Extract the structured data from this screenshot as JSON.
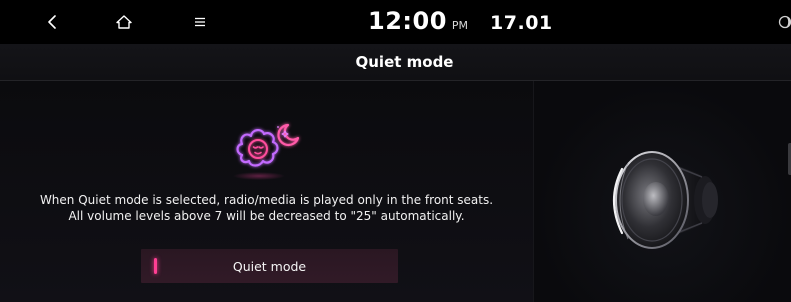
{
  "status_bar": {
    "time": "12:00",
    "ampm": "PM",
    "date": "17.01"
  },
  "title": "Quiet mode",
  "main": {
    "description_lines": [
      "When Quiet mode is selected, radio/media is played only in the front seats.",
      "All volume levels above 7 will be decreased to \"25\" automatically."
    ],
    "toggle_label": "Quiet mode"
  },
  "icons": {
    "back": "back-arrow-icon",
    "home": "home-icon",
    "menu": "menu-icon",
    "night": "night-mode-icon",
    "illustration": "sleeping-flower-moon-icon",
    "speaker": "speaker-icon"
  },
  "colors": {
    "accent": "#ff3f93",
    "neon_purple": "#b548ff",
    "toggle_bg": "#2e1925"
  }
}
